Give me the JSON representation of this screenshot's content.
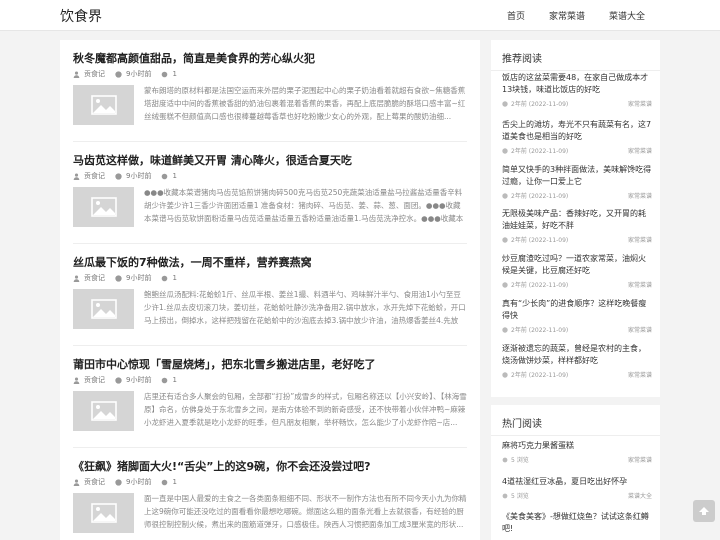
{
  "header": {
    "logo": "饮食界",
    "nav": [
      "首页",
      "家常菜谱",
      "菜谱大全"
    ]
  },
  "articles": [
    {
      "title": "秋冬魔都高颜值甜品，简直是美食界的芳心纵火犯",
      "author": "贡食记",
      "time": "9小时前",
      "views": "1",
      "excerpt": "蒙布朗塔的原材料都是法国空运而来外层的栗子泥围起中心的栗子奶油看着就超有食欲~焦糖香蕉塔甜度适中中间的香蕉被香甜的奶油包裹着混着香蕉的果香，再配上底层脆脆的酥塔口感丰富~红丝绒蛋糕不但颜值高口感也很棒蔓越莓香草也好吃粉嫩少女心的外观，配上莓果的酸奶油细..."
    },
    {
      "title": "马齿苋这样做，味道鲜美又开胃 清心降火，很适合夏天吃",
      "author": "贡食记",
      "time": "9小时前",
      "views": "1",
      "excerpt": "●●●收藏本菜谱猪肉马齿苋馅煎饼猪肉碎500克马齿苋250克蔬菜油适量盐马拉酱盐适量香辛料胡少许姜少许1三香少许面团适量1 准备食材：猪肉碎、马齿苋、姜、蒜、葱、面团。●●●收藏本菜谱马齿苋软饼面粉适量马齿苋适量盐适量五香粉适量油适量1.马齿苋洗净控水。●●●收藏本菜谱粉..."
    },
    {
      "title": "丝瓜最下饭的7种做法，一周不重样，营养赛燕窝",
      "author": "贡食记",
      "time": "9小时前",
      "views": "1",
      "excerpt": "鲍鲍丝瓜汤配料:花蛤蚧1斤、丝瓜半根、姜丝1撮、料酒半勺、鸡味鲜汁半勺、食用油1小勺至豆少许1.丝瓜去皮切滚刀块，姜切丝，花蛤蚧吐静沙洗净备用2.锅中放水，水开先焯下花蛤蚧，开口马上捞出，倒掉水，这样把残留在花蛤蚧中的沙泡底去掉3.锅中放少许油，油热爆香姜丝4.先放入..."
    },
    {
      "title": "莆田市中心惊现「雪屋烧烤」，把东北雪乡搬进店里，老好吃了",
      "author": "贡食记",
      "time": "9小时前",
      "views": "1",
      "excerpt": "店里还有适合多人聚会的包厢，全部都“打扮”成雪乡的样式，包厢名称还以【小兴安岭】、【林海雪原】命名，仿佛身处于东北雪乡之间，是南方体验不到的新奇感受，还不快带着小伙伴冲鸭~麻辣小龙虾进入夏季就是吃小龙虾的旺季，但凡朋友相聚，举杯畅饮，怎么能少了小龙虾作陪~店..."
    },
    {
      "title": "《狂飙》猪脚面大火!“舌尖”上的这9碗，你不会还没尝过吧?",
      "author": "贡食记",
      "time": "9小时前",
      "views": "1",
      "excerpt": "面一直是中国人最爱的主食之一各类面条粗细不同、形状不一制作方法也有所不同今天小九为你精上这9碗你可能还没吃过的面看看你最想吃哪碗。燃面这么粗的面条光看上去就很香，有经验的厨师很控制控制火候，煮出来的面筋道弹牙，口感极佳。陕西人习惯把面条加工成3厘米宽的形状..."
    }
  ],
  "recommend": {
    "title": "推荐阅读",
    "items": [
      {
        "title": "饭店的这盆菜需要48，在家自己做成本才13块钱，味道比饭店的好吃",
        "date": "2年前 (2022-11-09)",
        "cat": "家常菜谱"
      },
      {
        "title": "舌尖上的滩坊，寿光不只有蔬菜有名，这7道美食也是相当的好吃",
        "date": "2年前 (2022-11-09)",
        "cat": "家常菜谱"
      },
      {
        "title": "简单又快手的3种拌面做法，美味解馋吃得过瘾，让你一口爱上它",
        "date": "2年前 (2022-11-09)",
        "cat": "家常菜谱"
      },
      {
        "title": "无限极美味产品：香辣好吃，又开胃的耗油娃娃菜，好吃不胖",
        "date": "2年前 (2022-11-09)",
        "cat": "家常菜谱"
      },
      {
        "title": "炒豆腐渣吃过吗？一道农家常菜，油焖火候是关键，比豆腐还好吃",
        "date": "2年前 (2022-11-09)",
        "cat": "家常菜谱"
      },
      {
        "title": "真有“少长肉”的进食顺序？这样吃晚餐瘦得快",
        "date": "2年前 (2022-11-09)",
        "cat": "家常菜谱"
      },
      {
        "title": "逐渐被遗忘的蔬菜，曾经是农村的主食，烧汤做饼炒菜，样样都好吃",
        "date": "2年前 (2022-11-09)",
        "cat": "家常菜谱"
      }
    ]
  },
  "hot": {
    "title": "热门阅读",
    "items": [
      {
        "title": "麻将巧克力果酱蛋糕",
        "views": "5 浏览",
        "cat": "家常菜谱"
      },
      {
        "title": "4道祛湿红豆冰晶，夏日吃出好怀孕",
        "views": "5 浏览",
        "cat": "菜谱大全"
      },
      {
        "title": "《美食美客》-想做红烧鱼？试试这条红鳟吧!",
        "views": "",
        "cat": ""
      }
    ]
  }
}
